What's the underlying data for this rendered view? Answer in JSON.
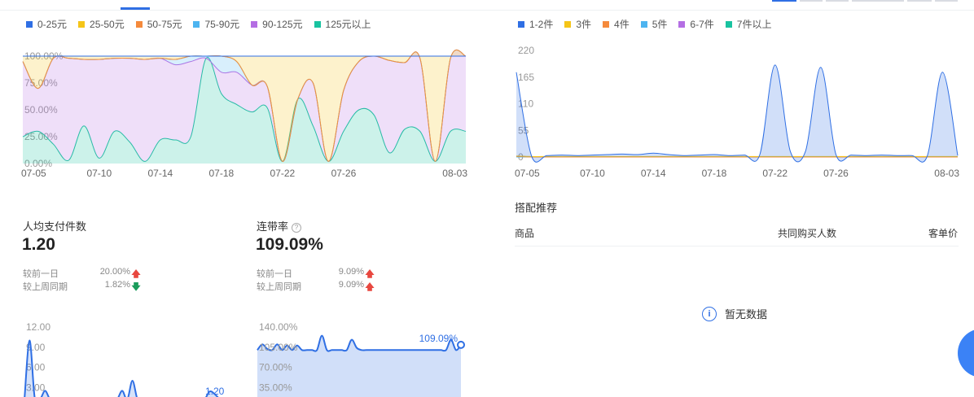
{
  "colors": {
    "primary": "#2f6fe4",
    "up": "#e8473f",
    "down": "#1a9c5b",
    "price_bands": [
      "#2f6fe4",
      "#f5c518",
      "#f58a3c",
      "#4db4f0",
      "#b46ee3",
      "#19c3a0"
    ]
  },
  "left_legend": [
    "0-25元",
    "25-50元",
    "50-75元",
    "75-90元",
    "90-125元",
    "125元以上"
  ],
  "right_legend": [
    "1-2件",
    "3件",
    "4件",
    "5件",
    "6-7件",
    "7件以上"
  ],
  "metrics": {
    "per_capita": {
      "title": "人均支付件数",
      "value": "1.20",
      "cmp_day_label": "较前一日",
      "cmp_day_value": "20.00%",
      "cmp_week_label": "较上周同期",
      "cmp_week_value": "1.82%"
    },
    "joint_rate": {
      "title": "连带率",
      "value": "109.09%",
      "help": "?",
      "cmp_day_label": "较前一日",
      "cmp_day_value": "9.09%",
      "cmp_week_label": "较上周同期",
      "cmp_week_value": "9.09%"
    }
  },
  "recommend": {
    "title": "搭配推荐",
    "col_product": "商品",
    "col_buyers": "共同购买人数",
    "col_unit_price": "客单价",
    "empty_text": "暂无数据",
    "info_glyph": "i"
  },
  "chart_data": [
    {
      "type": "area",
      "stacked": "percent",
      "x_ticks": [
        "07-05",
        "07-10",
        "07-14",
        "07-18",
        "07-22",
        "07-26",
        "08-03"
      ],
      "ylabel_ticks": [
        "0.00%",
        "25.00%",
        "50.00%",
        "75.00%",
        "100.00%"
      ],
      "ylim": [
        0,
        100
      ],
      "x": [
        "07-05",
        "07-06",
        "07-07",
        "07-08",
        "07-09",
        "07-10",
        "07-11",
        "07-12",
        "07-13",
        "07-14",
        "07-15",
        "07-16",
        "07-17",
        "07-18",
        "07-19",
        "07-20",
        "07-21",
        "07-22",
        "07-23",
        "07-24",
        "07-25",
        "07-26",
        "07-27",
        "07-28",
        "07-29",
        "07-30",
        "07-31",
        "08-01",
        "08-02",
        "08-03"
      ],
      "series": [
        {
          "name": "125元以上",
          "values": [
            25,
            30,
            18,
            3,
            35,
            5,
            30,
            20,
            2,
            22,
            22,
            25,
            98,
            65,
            55,
            48,
            52,
            2,
            60,
            35,
            2,
            30,
            50,
            45,
            10,
            32,
            30,
            2,
            30,
            30
          ]
        },
        {
          "name": "90-125元",
          "values": [
            70,
            40,
            80,
            95,
            62,
            92,
            68,
            78,
            95,
            76,
            70,
            70,
            0,
            20,
            30,
            25,
            20,
            0,
            0,
            40,
            0,
            38,
            45,
            55,
            86,
            62,
            68,
            0,
            68,
            70
          ]
        },
        {
          "name": "75-90元",
          "values": [
            0,
            0,
            0,
            0,
            0,
            0,
            0,
            0,
            0,
            0,
            5,
            5,
            2,
            15,
            10,
            0,
            0,
            0,
            0,
            0,
            0,
            0,
            0,
            0,
            0,
            0,
            0,
            0,
            0,
            0
          ]
        },
        {
          "name": "50-75元",
          "values": [
            0,
            0,
            0,
            0,
            0,
            0,
            0,
            0,
            0,
            0,
            0,
            0,
            0,
            0,
            0,
            0,
            0,
            0,
            0,
            0,
            0,
            0,
            0,
            0,
            0,
            0,
            0,
            0,
            0,
            0
          ]
        },
        {
          "name": "25-50元",
          "values": [
            5,
            30,
            2,
            2,
            3,
            3,
            2,
            2,
            3,
            2,
            3,
            0,
            0,
            0,
            5,
            27,
            28,
            98,
            40,
            25,
            98,
            32,
            5,
            0,
            4,
            6,
            2,
            98,
            2,
            0
          ]
        },
        {
          "name": "0-25元",
          "values": [
            0,
            0,
            0,
            0,
            0,
            0,
            0,
            0,
            0,
            0,
            0,
            0,
            0,
            0,
            0,
            0,
            0,
            0,
            0,
            0,
            0,
            0,
            0,
            0,
            0,
            0,
            0,
            0,
            0,
            0
          ]
        }
      ]
    },
    {
      "type": "area",
      "x_ticks": [
        "07-05",
        "07-10",
        "07-14",
        "07-18",
        "07-22",
        "07-26",
        "08-03"
      ],
      "ylabel_ticks": [
        "0",
        "55",
        "110",
        "165",
        "220"
      ],
      "ylim": [
        0,
        220
      ],
      "x": [
        "07-05",
        "07-06",
        "07-07",
        "07-08",
        "07-09",
        "07-10",
        "07-11",
        "07-12",
        "07-13",
        "07-14",
        "07-15",
        "07-16",
        "07-17",
        "07-18",
        "07-19",
        "07-20",
        "07-21",
        "07-22",
        "07-23",
        "07-24",
        "07-25",
        "07-26",
        "07-27",
        "07-28",
        "07-29",
        "07-30",
        "07-31",
        "08-01",
        "08-02",
        "08-03"
      ],
      "series": [
        {
          "name": "1-2件",
          "values": [
            175,
            2,
            3,
            4,
            3,
            4,
            5,
            6,
            5,
            8,
            5,
            3,
            4,
            5,
            3,
            4,
            5,
            190,
            12,
            12,
            185,
            5,
            4,
            3,
            4,
            3,
            3,
            2,
            175,
            3
          ]
        },
        {
          "name": "3件",
          "values": [
            2,
            1,
            1,
            1,
            1,
            1,
            1,
            1,
            1,
            1,
            1,
            1,
            1,
            1,
            1,
            1,
            1,
            1,
            1,
            1,
            1,
            1,
            1,
            1,
            1,
            1,
            1,
            1,
            1,
            1
          ]
        },
        {
          "name": "4件",
          "values": [
            1,
            0,
            0,
            0,
            0,
            0,
            0,
            0,
            0,
            0,
            0,
            0,
            0,
            0,
            0,
            0,
            0,
            0,
            0,
            0,
            0,
            0,
            0,
            0,
            0,
            0,
            0,
            0,
            0,
            0
          ]
        },
        {
          "name": "5件",
          "values": [
            0,
            0,
            0,
            0,
            0,
            0,
            0,
            0,
            0,
            0,
            0,
            0,
            0,
            0,
            0,
            0,
            0,
            0,
            0,
            0,
            0,
            0,
            0,
            0,
            0,
            0,
            0,
            0,
            0,
            0
          ]
        },
        {
          "name": "6-7件",
          "values": [
            0,
            0,
            0,
            0,
            0,
            0,
            0,
            0,
            0,
            0,
            0,
            0,
            0,
            0,
            0,
            0,
            0,
            0,
            0,
            0,
            0,
            0,
            0,
            0,
            0,
            0,
            0,
            0,
            0,
            0
          ]
        },
        {
          "name": "7件以上",
          "values": [
            0,
            0,
            0,
            0,
            0,
            0,
            0,
            0,
            0,
            0,
            0,
            0,
            0,
            0,
            0,
            0,
            0,
            0,
            0,
            0,
            0,
            0,
            0,
            0,
            0,
            0,
            0,
            0,
            0,
            0
          ]
        }
      ]
    },
    {
      "type": "line",
      "ylabel_ticks": [
        "3.00",
        "6.00",
        "9.00",
        "12.00"
      ],
      "ylim": [
        0,
        12
      ],
      "end_label": "1.20",
      "series": [
        {
          "name": "人均支付件数",
          "values": [
            1.2,
            10,
            1.5,
            1.2,
            2.5,
            1.2,
            1.2,
            1.2,
            1.4,
            1.2,
            1.2,
            1.2,
            1.2,
            1.2,
            1.2,
            1.2,
            1.2,
            1.2,
            1.2,
            2.5,
            1.2,
            4,
            1.2,
            1.2,
            1.2,
            1.2,
            1.2,
            1.2,
            1.2,
            1.2,
            1.2,
            1.2,
            1.4,
            1.2,
            1.2,
            1.2,
            2.4,
            2.0,
            1.2
          ]
        }
      ]
    },
    {
      "type": "area",
      "ylabel_ticks": [
        "35.00%",
        "70.00%",
        "105.00%",
        "140.00%"
      ],
      "ylim": [
        0,
        140
      ],
      "end_label": "109.09%",
      "series": [
        {
          "name": "连带率",
          "values": [
            100,
            110,
            102,
            100,
            110,
            100,
            108,
            100,
            108,
            100,
            100,
            100,
            100,
            125,
            100,
            100,
            100,
            100,
            100,
            118,
            104,
            100,
            100,
            100,
            100,
            100,
            100,
            100,
            100,
            100,
            100,
            100,
            100,
            100,
            100,
            100,
            100,
            100,
            100,
            118,
            100,
            109.09
          ]
        }
      ]
    }
  ]
}
